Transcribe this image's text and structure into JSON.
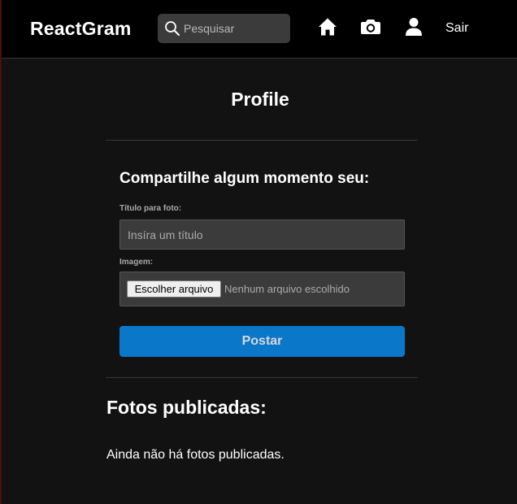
{
  "navbar": {
    "brand": "ReactGram",
    "search_placeholder": "Pesquisar",
    "icons": [
      "home-icon",
      "camera-icon",
      "user-icon"
    ],
    "logout_label": "Sair"
  },
  "profile": {
    "title": "Profile"
  },
  "new_photo_form": {
    "heading": "Compartilhe algum momento seu:",
    "title_label": "Título para foto:",
    "title_placeholder": "Insíra um título",
    "title_value": "",
    "image_label": "Imagem:",
    "file_button_label": "Escolher arquivo",
    "file_status": "Nenhum arquivo escolhido",
    "submit_label": "Postar"
  },
  "photos": {
    "heading": "Fotos publicadas:",
    "empty_message": "Ainda não há fotos publicadas."
  },
  "colors": {
    "background": "#121212",
    "navbar": "#000000",
    "input_bg": "#3b3b3b",
    "primary_button": "#0a77c9"
  }
}
